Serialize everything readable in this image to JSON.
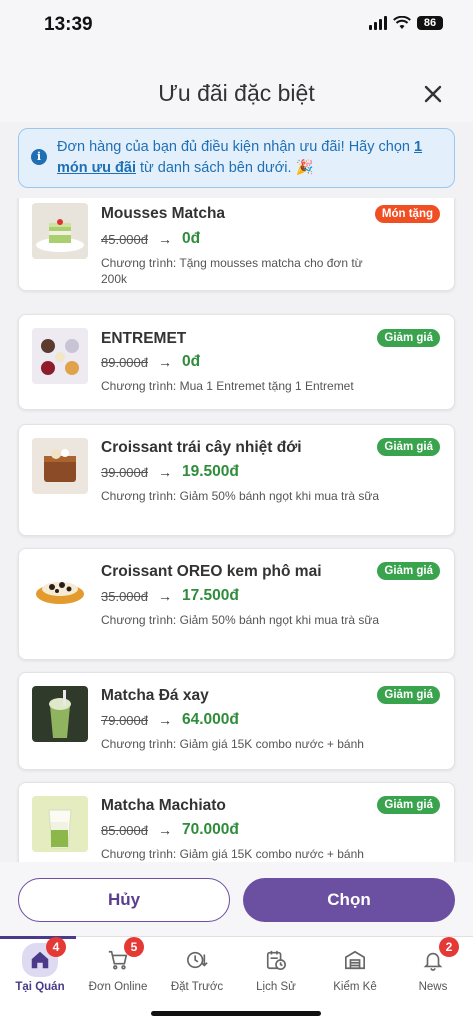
{
  "status_bar": {
    "time": "13:39",
    "battery": "86"
  },
  "header": {
    "title": "Ưu đãi đặc biệt"
  },
  "notice": {
    "text_before": "Đơn hàng của bạn đủ điều kiện nhận ưu đãi! Hãy chọn ",
    "link": "1 món ưu đãi",
    "text_after": " từ danh sách bên dưới. 🎉"
  },
  "items": [
    {
      "name": "Mousses Matcha",
      "badge": "Món tặng",
      "badge_type": "gift",
      "old_price": "45.000đ",
      "new_price": "0đ",
      "program": "Chương trình: Tặng mousses matcha cho đơn từ 200k"
    },
    {
      "name": "ENTREMET",
      "badge": "Giảm giá",
      "badge_type": "sale",
      "old_price": "89.000đ",
      "new_price": "0đ",
      "program": "Chương trình: Mua 1 Entremet tặng 1 Entremet"
    },
    {
      "name": "Croissant trái cây nhiệt đới",
      "badge": "Giảm giá",
      "badge_type": "sale",
      "old_price": "39.000đ",
      "new_price": "19.500đ",
      "program": "Chương trình: Giảm 50% bánh ngọt khi mua trà sữa"
    },
    {
      "name": "Croissant OREO kem phô mai",
      "badge": "Giảm giá",
      "badge_type": "sale",
      "old_price": "35.000đ",
      "new_price": "17.500đ",
      "program": "Chương trình: Giảm 50% bánh ngọt khi mua trà sữa"
    },
    {
      "name": "Matcha Đá xay",
      "badge": "Giảm giá",
      "badge_type": "sale",
      "old_price": "79.000đ",
      "new_price": "64.000đ",
      "program": "Chương trình: Giảm giá 15K combo nước + bánh"
    },
    {
      "name": "Matcha Machiato",
      "badge": "Giảm giá",
      "badge_type": "sale",
      "old_price": "85.000đ",
      "new_price": "70.000đ",
      "program": "Chương trình: Giảm giá 15K combo nước + bánh"
    }
  ],
  "actions": {
    "cancel": "Hủy",
    "choose": "Chọn"
  },
  "tabs": [
    {
      "label": "Tại Quán",
      "badge": "4",
      "icon": "home-icon"
    },
    {
      "label": "Đơn Online",
      "badge": "5",
      "icon": "cart-icon"
    },
    {
      "label": "Đặt Trước",
      "badge": "",
      "icon": "clock-down-icon"
    },
    {
      "label": "Lịch Sử",
      "badge": "",
      "icon": "history-icon"
    },
    {
      "label": "Kiểm Kê",
      "badge": "",
      "icon": "warehouse-icon"
    },
    {
      "label": "News",
      "badge": "2",
      "icon": "bell-icon"
    }
  ],
  "colors": {
    "primary": "#6b4fa0",
    "gift_badge": "#f04e23",
    "sale_badge": "#3aa34e",
    "price_green": "#2f8c3b",
    "notice_bg": "#e3f0fb"
  }
}
